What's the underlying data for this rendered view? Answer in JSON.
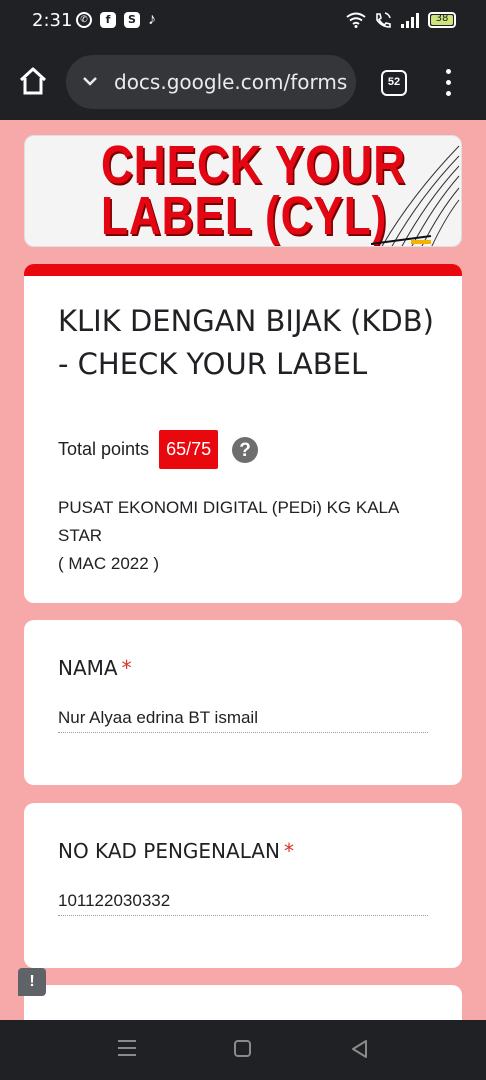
{
  "status_bar": {
    "time": "2:31",
    "apps": [
      "whatsapp-icon",
      "facebook-icon",
      "shopee-icon",
      "tiktok-icon"
    ],
    "battery": "38",
    "battery_level": 0.38
  },
  "browser": {
    "url": "docs.google.com/forms",
    "tab_count": "52"
  },
  "banner": {
    "text": "CHECK YOUR LABEL (CYL)"
  },
  "form": {
    "title": "KLIK DENGAN BIJAK (KDB) - CHECK YOUR LABEL",
    "points_label": "Total points",
    "points_value": "65/75",
    "description_line1": "PUSAT EKONOMI DIGITAL (PEDi) KG KALA STAR",
    "description_line2": "( MAC 2022 )",
    "accent_color": "#e8080e",
    "background_color": "#f7a8a8"
  },
  "questions": [
    {
      "label": "NAMA",
      "required_mark": "*",
      "answer": "Nur Alyaa edrina BT ismail"
    },
    {
      "label": "NO KAD PENGENALAN",
      "required_mark": "*",
      "answer": "101122030332"
    }
  ]
}
